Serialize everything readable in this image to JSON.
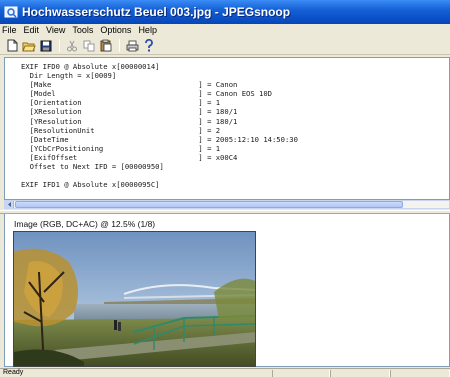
{
  "window": {
    "title": "Hochwasserschutz Beuel 003.jpg - JPEGsnoop"
  },
  "menu": {
    "items": [
      "File",
      "Edit",
      "View",
      "Tools",
      "Options",
      "Help"
    ]
  },
  "toolbar": {
    "buttons": [
      "new-icon",
      "open-icon",
      "save-icon",
      "cut-icon",
      "copy-icon",
      "paste-icon",
      "print-icon",
      "help-icon"
    ]
  },
  "report": {
    "lines": [
      "EXIF IFD0 @ Absolute x[00000014]",
      "  Dir Length = x[0009]",
      "  [Make                                  ] = Canon",
      "  [Model                                 ] = Canon EOS 10D",
      "  [Orientation                           ] = 1",
      "  [XResolution                           ] = 180/1",
      "  [YResolution                           ] = 180/1",
      "  [ResolutionUnit                        ] = 2",
      "  [DateTime                              ] = 2005:12:10 14:50:30",
      "  [YCbCrPositioning                      ] = 1",
      "  [ExifOffset                            ] = x00C4",
      "  Offset to Next IFD = [00000950]",
      "",
      "EXIF IFD1 @ Absolute x[0000095C]"
    ]
  },
  "image_view": {
    "caption": "Image (RGB, DC+AC) @ 12.5% (1/8)"
  },
  "status": {
    "text": "Ready"
  },
  "colors": {
    "titlebar": "#0a4ec6",
    "background": "#ece9d8",
    "desktop": "#e8b53a"
  }
}
